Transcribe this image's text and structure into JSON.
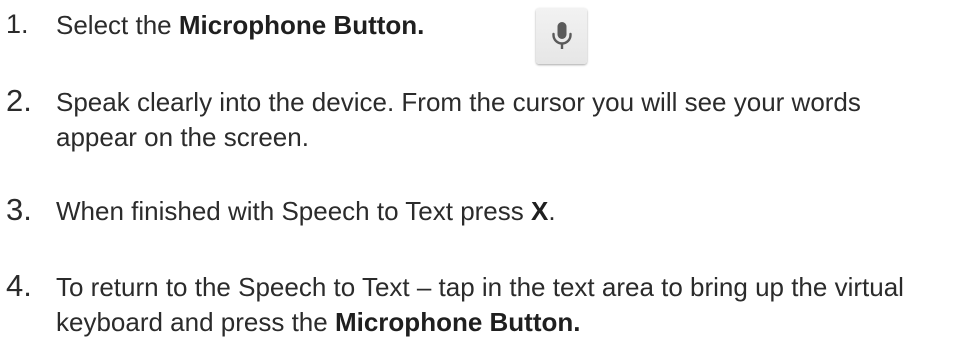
{
  "steps": [
    {
      "number": "1.",
      "text_before": "Select the ",
      "bold": "Microphone Button.",
      "text_after": ""
    },
    {
      "number": "2.",
      "text_before": "Speak clearly into the device. From the cursor you will see your words appear on the screen.",
      "bold": "",
      "text_after": ""
    },
    {
      "number": "3.",
      "text_before": "When finished with Speech to Text press ",
      "bold": "X",
      "text_after": "."
    },
    {
      "number": "4.",
      "text_before": "To return to the Speech to Text – tap in the text area to bring up the virtual keyboard and press the ",
      "bold": "Microphone Button.",
      "text_after": ""
    }
  ],
  "mic_button": {
    "icon": "microphone-icon",
    "icon_color": "#5a5a5a"
  }
}
